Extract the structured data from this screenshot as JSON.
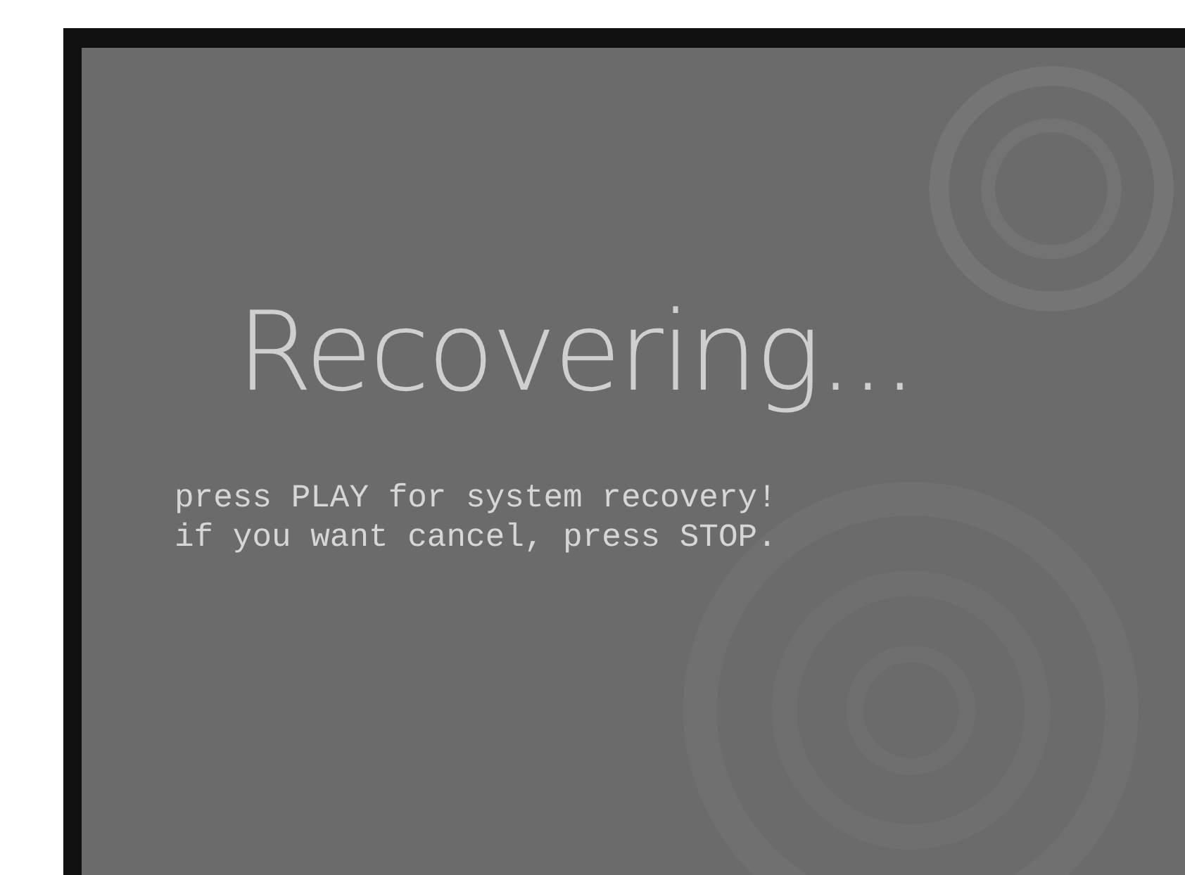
{
  "screen": {
    "title": "Recovering...",
    "message_lines": [
      "press PLAY for system recovery!",
      "if you want cancel, press STOP."
    ]
  }
}
